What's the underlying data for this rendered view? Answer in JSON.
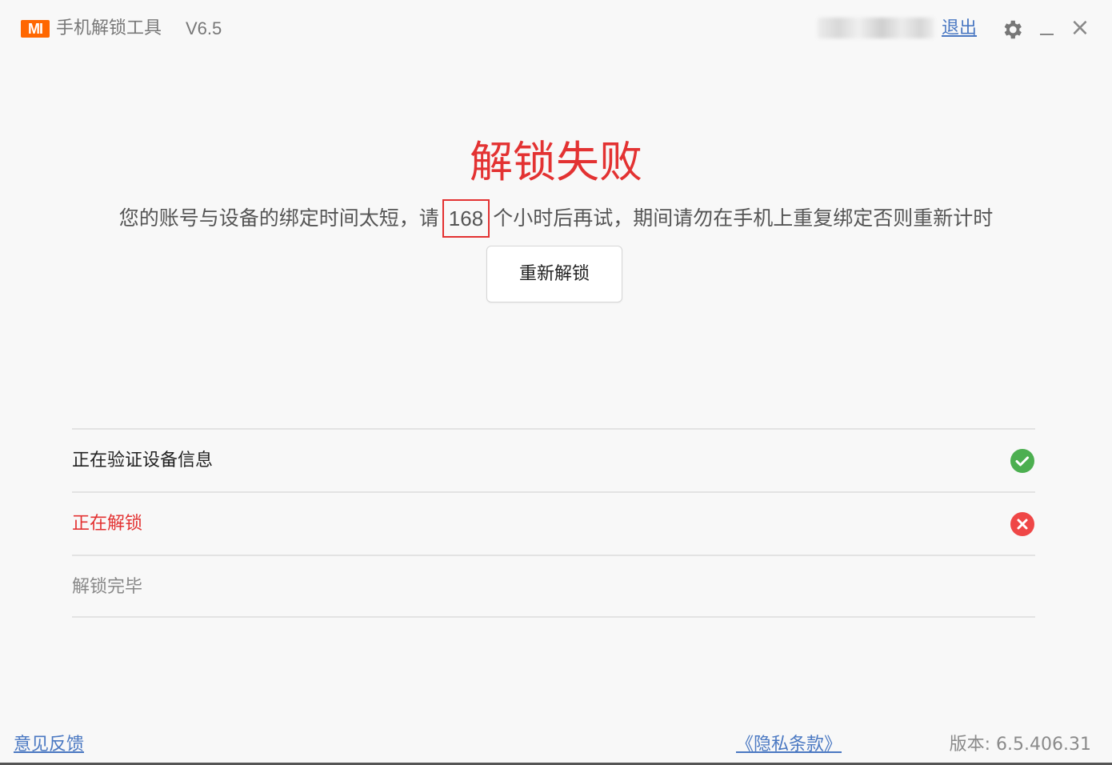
{
  "titlebar": {
    "logo_text": "MI",
    "app_title": "手机解锁工具",
    "version": "V6.5",
    "logout_label": "退出",
    "close_glyph": "×",
    "icons": [
      "mi-logo-icon",
      "gear-icon",
      "minimize-icon",
      "close-icon"
    ]
  },
  "result": {
    "title": "解锁失败",
    "message_prefix": "您的账号与设备的绑定时间太短，请",
    "wait_hours": "168",
    "message_suffix": "个小时后再试，期间请勿在手机上重复绑定否则重新计时",
    "retry_label": "重新解锁"
  },
  "steps": [
    {
      "label": "正在验证设备信息",
      "status": "success"
    },
    {
      "label": "正在解锁",
      "status": "failed"
    },
    {
      "label": "解锁完毕",
      "status": "pending"
    }
  ],
  "footer": {
    "feedback_label": "意见反馈",
    "privacy_label": "《隐私条款》",
    "version_label": "版本: 6.5.406.31"
  },
  "colors": {
    "brand": "#ff6700",
    "error": "#e33232",
    "success": "#4caf50",
    "link": "#4a78c2"
  }
}
